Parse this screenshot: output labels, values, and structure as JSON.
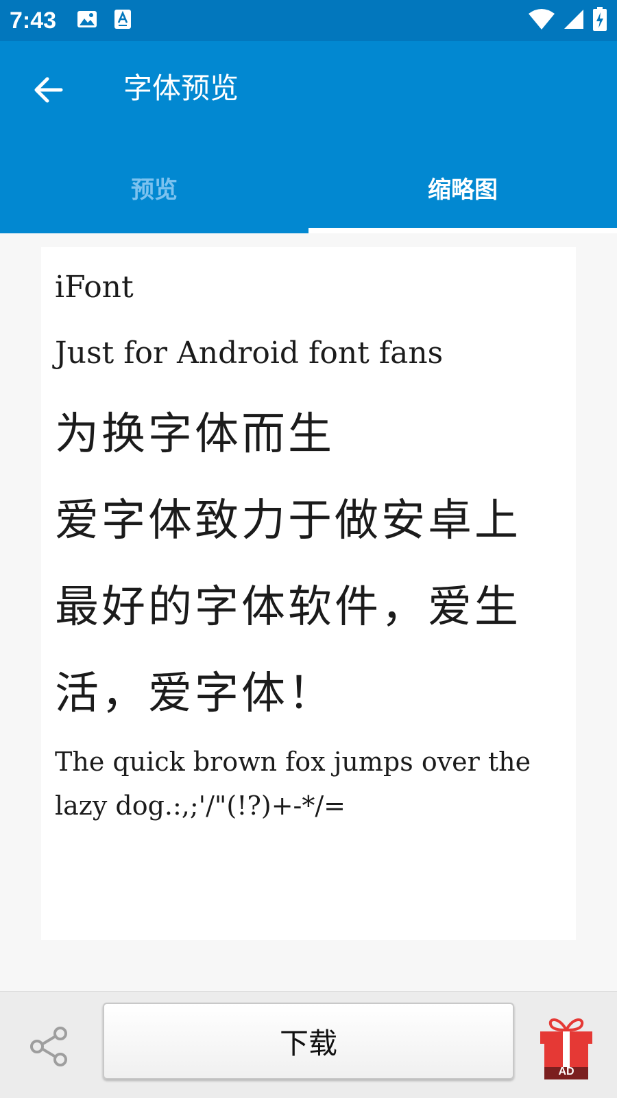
{
  "status_bar": {
    "time": "7:43",
    "icons": [
      "image-icon",
      "font-a-icon",
      "wifi-icon",
      "cell-signal-icon",
      "battery-charging-icon"
    ]
  },
  "app_bar": {
    "title": "字体预览",
    "back_icon": "arrow-left-icon"
  },
  "tabs": [
    {
      "label": "预览",
      "selected": false
    },
    {
      "label": "缩略图",
      "selected": true
    }
  ],
  "preview": {
    "lines": [
      "iFont",
      "Just for Android font fans",
      "为换字体而生",
      "爱字体致力于做安卓上",
      "最好的字体软件，爱生",
      "活，爱字体！",
      "The quick brown fox jumps over the",
      "lazy dog.:,;'/\"(!?)+-*/="
    ]
  },
  "bottom_bar": {
    "download_label": "下载",
    "ad_label": "AD"
  },
  "colors": {
    "status_bar": "#0277bd",
    "app_bar": "#0288d1",
    "tab_inactive_text": "#7cc2ef",
    "ad_red": "#e53935"
  }
}
